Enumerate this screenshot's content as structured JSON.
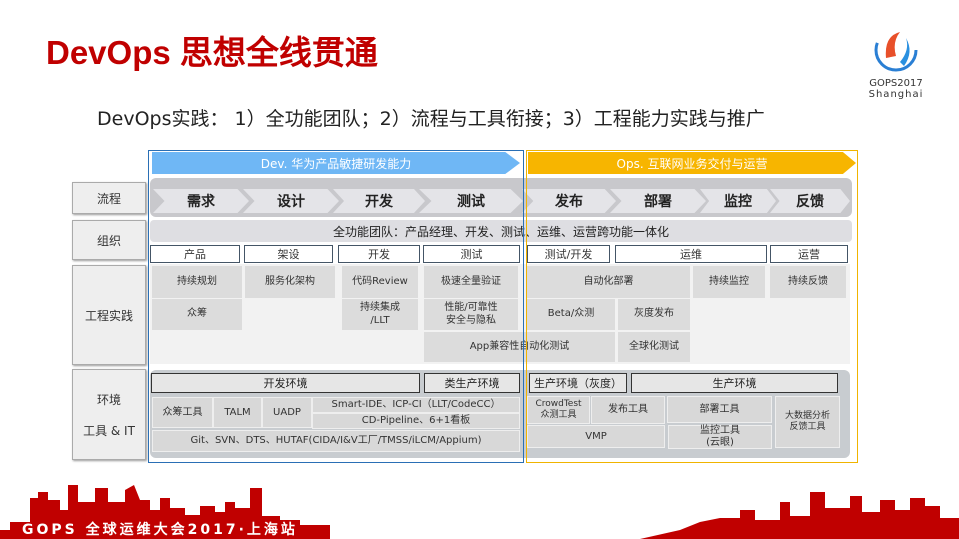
{
  "title": "DevOps 思想全线贯通",
  "subtitle": "DevOps实践： 1）全功能团队；2）流程与工具衔接；3）工程能力实践与推广",
  "logo": {
    "line1": "GOPS2017",
    "line2": "Shanghai"
  },
  "footer": "GOPS 全球运维大会2017·上海站",
  "colors": {
    "accent": "#c00000",
    "dev": "#6fb7f5",
    "ops": "#f7b500"
  },
  "row_labels": [
    "流程",
    "组织",
    "工程实践",
    "环境\n\n工具 & IT"
  ],
  "dev_banner": "Dev. 华为产品敏捷研发能力",
  "ops_banner": "Ops. 互联网业务交付与运营",
  "process": [
    "需求",
    "设计",
    "开发",
    "测试",
    "发布",
    "部署",
    "监控",
    "反馈"
  ],
  "team": "全功能团队：产品经理、开发、测试、运维、运营跨功能一体化",
  "roles": [
    "产品",
    "架设",
    "开发",
    "测试",
    "测试/开发",
    "运维",
    "运营"
  ],
  "practices": [
    "持续规划",
    "服务化架构",
    "代码Review",
    "极速全量验证",
    "众筹",
    "持续集成\n/LLT",
    "性能/可靠性\n安全与隐私",
    "App兼容性自动化测试",
    "自动化部署",
    "持续监控",
    "持续反馈",
    "Beta/众测",
    "灰度发布",
    "全球化测试"
  ],
  "environments": [
    "开发环境",
    "类生产环境",
    "生产环境（灰度）",
    "生产环境"
  ],
  "tools": [
    "众筹工具",
    "TALM",
    "UADP",
    "Smart-IDE、ICP-CI（LLT/CodeCC）",
    "CD-Pipeline、6+1看板",
    "Git、SVN、DTS、HUTAF(CIDA/I&V工厂/TMSS/iLCM/Appium)",
    "CrowdTest\n众测工具",
    "发布工具",
    "部署工具",
    "大数据分析\n反馈工具",
    "VMP",
    "监控工具\n(云眼)"
  ]
}
